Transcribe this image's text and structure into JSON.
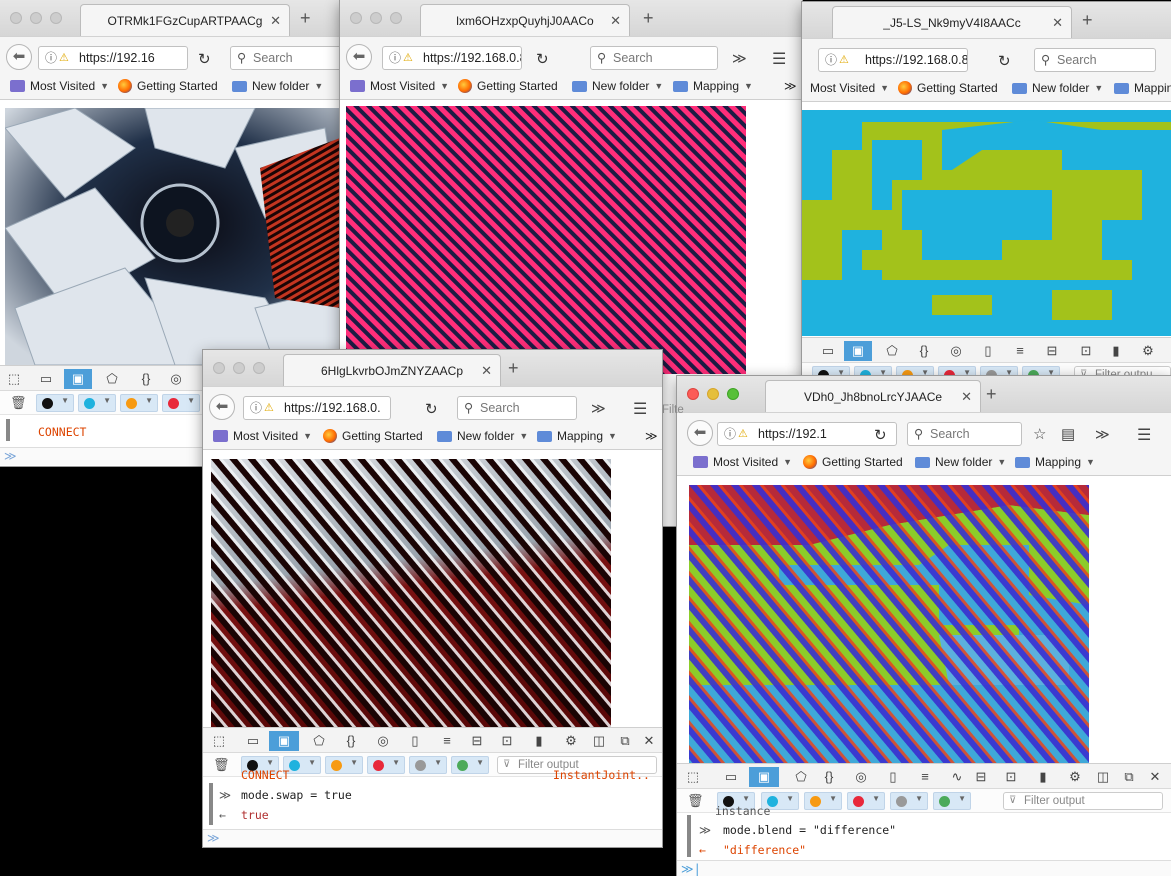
{
  "bookmarks": {
    "most_visited": "Most Visited",
    "getting_started": "Getting Started",
    "new_folder": "New folder",
    "mapping": "Mapping",
    "mapping_cut": "Mappin"
  },
  "common": {
    "search_placeholder": "Search",
    "filter_placeholder": "Filter output",
    "filter_cut": "Filter outpu",
    "filter_cut2": "Filte"
  },
  "window1": {
    "tab_title": "OTRMk1FGzCupARTPAACg",
    "url": "https://192.16",
    "console_text": "CONNECT"
  },
  "window2": {
    "tab_title": "lxm6OHzxpQuyhjJ0AACo",
    "url": "https://192.168.0.8"
  },
  "window3": {
    "tab_title": "_J5-LS_Nk9myV4I8AACc",
    "url": "https://192.168.0.8"
  },
  "window4": {
    "tab_title": "6HlgLkvrbOJmZNYZAACp",
    "url": "https://192.168.0.",
    "console": {
      "partial_left": "CONNECT",
      "partial_right": "InstantJoint..",
      "command": "mode.swap = true",
      "result": "true"
    }
  },
  "window5": {
    "tab_title": "VDh0_Jh8bnoLrcYJAACe",
    "url": "https://192.1",
    "console": {
      "partial": "instance",
      "command": "mode.blend = \"difference\"",
      "result": "\"difference\""
    }
  },
  "colors": {
    "accent": "#4c9ed9",
    "stripe_pink": "#ff2e7a",
    "stripe_dark": "#1a1a40",
    "lime": "#a3c21b",
    "cyan": "#1fb2de",
    "console_orange": "#dd4400"
  },
  "icons": {
    "back": "back-arrow-icon",
    "info": "info-icon",
    "warning": "warning-icon",
    "reload": "reload-icon",
    "search": "search-icon",
    "overflow": "overflow-chevron-icon",
    "menu": "hamburger-menu-icon",
    "star": "bookmark-star-icon",
    "library": "library-icon",
    "trash": "trash-icon",
    "filter": "filter-funnel-icon"
  }
}
